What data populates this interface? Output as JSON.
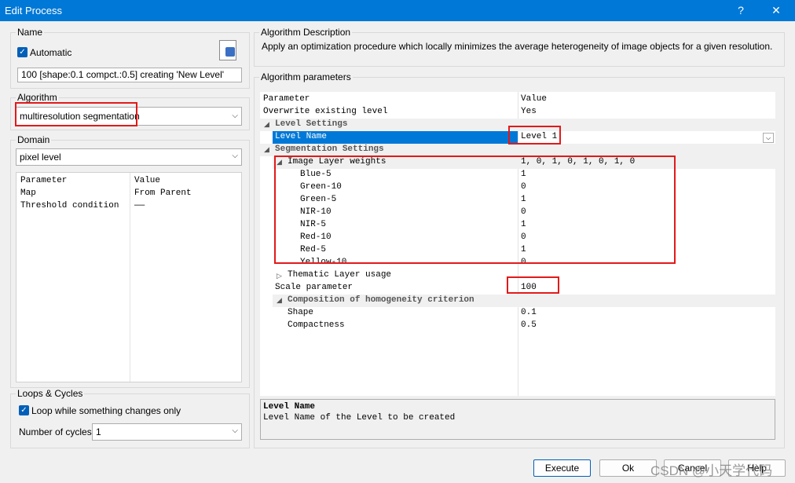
{
  "window": {
    "title": "Edit Process",
    "help_label": "?",
    "close_label": "✕"
  },
  "name_group": {
    "label": "Name",
    "automatic_label": "Automatic",
    "value": "100 [shape:0.1 compct.:0.5] creating 'New Level'"
  },
  "algorithm_group": {
    "label": "Algorithm",
    "value": "multiresolution segmentation"
  },
  "domain_group": {
    "label": "Domain",
    "value": "pixel level",
    "headers": [
      "Parameter",
      "Value"
    ],
    "rows": [
      {
        "param": "Map",
        "value": "From Parent"
      },
      {
        "param": "Threshold condition",
        "value": "——"
      }
    ]
  },
  "loops_group": {
    "label": "Loops & Cycles",
    "loop_label": "Loop while something changes only",
    "cycles_label": "Number of cycles",
    "cycles_value": "1"
  },
  "description_group": {
    "label": "Algorithm Description",
    "text": "Apply an optimization procedure which locally minimizes the average heterogeneity of image objects for a given resolution."
  },
  "params_group": {
    "label": "Algorithm parameters",
    "headers": [
      "Parameter",
      "Value"
    ],
    "rows": [
      {
        "name": "Overwrite existing level",
        "value": "Yes"
      },
      {
        "name": "Level Settings",
        "value": ""
      },
      {
        "name": "Level Name",
        "value": "Level 1"
      },
      {
        "name": "Segmentation Settings",
        "value": ""
      },
      {
        "name": "Image Layer weights",
        "value": "1, 0, 1, 0, 1, 0, 1, 0"
      },
      {
        "name": "Blue-5",
        "value": "1"
      },
      {
        "name": "Green-10",
        "value": "0"
      },
      {
        "name": "Green-5",
        "value": "1"
      },
      {
        "name": "NIR-10",
        "value": "0"
      },
      {
        "name": "NIR-5",
        "value": "1"
      },
      {
        "name": "Red-10",
        "value": "0"
      },
      {
        "name": "Red-5",
        "value": "1"
      },
      {
        "name": "Yellow-10",
        "value": "0"
      },
      {
        "name": "Thematic Layer usage",
        "value": ""
      },
      {
        "name": "Scale parameter",
        "value": "100"
      },
      {
        "name": "Composition of homogeneity criterion",
        "value": ""
      },
      {
        "name": "Shape",
        "value": "0.1"
      },
      {
        "name": "Compactness",
        "value": "0.5"
      }
    ],
    "help_title": "Level Name",
    "help_text": "Level Name of the Level to be created"
  },
  "buttons": {
    "execute": "Execute",
    "ok": "Ok",
    "cancel": "Cancel",
    "help": "Help"
  },
  "watermark": "CSDN @小天学代码"
}
